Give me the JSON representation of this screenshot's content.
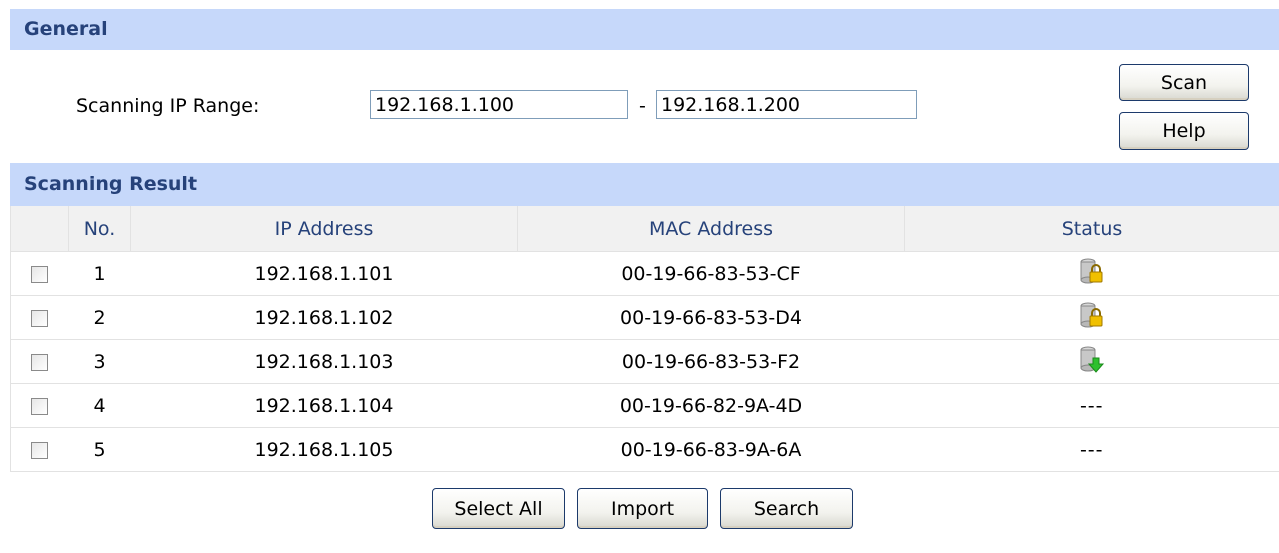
{
  "general": {
    "header": "General",
    "range_label": "Scanning IP Range:",
    "ip_start": "192.168.1.100",
    "range_separator": "-",
    "ip_end": "192.168.1.200",
    "scan_label": "Scan",
    "help_label": "Help"
  },
  "result": {
    "header": "Scanning Result",
    "columns": [
      "",
      "No.",
      "IP Address",
      "MAC Address",
      "Status"
    ],
    "rows": [
      {
        "no": "1",
        "ip": "192.168.1.101",
        "mac": "00-19-66-83-53-CF",
        "status": "lock-icon",
        "status_text": ""
      },
      {
        "no": "2",
        "ip": "192.168.1.102",
        "mac": "00-19-66-83-53-D4",
        "status": "lock-icon",
        "status_text": ""
      },
      {
        "no": "3",
        "ip": "192.168.1.103",
        "mac": "00-19-66-83-53-F2",
        "status": "download-icon",
        "status_text": ""
      },
      {
        "no": "4",
        "ip": "192.168.1.104",
        "mac": "00-19-66-82-9A-4D",
        "status": "none",
        "status_text": "---"
      },
      {
        "no": "5",
        "ip": "192.168.1.105",
        "mac": "00-19-66-83-9A-6A",
        "status": "none",
        "status_text": "---"
      }
    ]
  },
  "footer": {
    "select_all_label": "Select All",
    "import_label": "Import",
    "search_label": "Search"
  },
  "colors": {
    "header_bg": "#c6d8fa",
    "header_text": "#26427a",
    "lock_color": "#f0c000",
    "download_color": "#2ec02e"
  }
}
